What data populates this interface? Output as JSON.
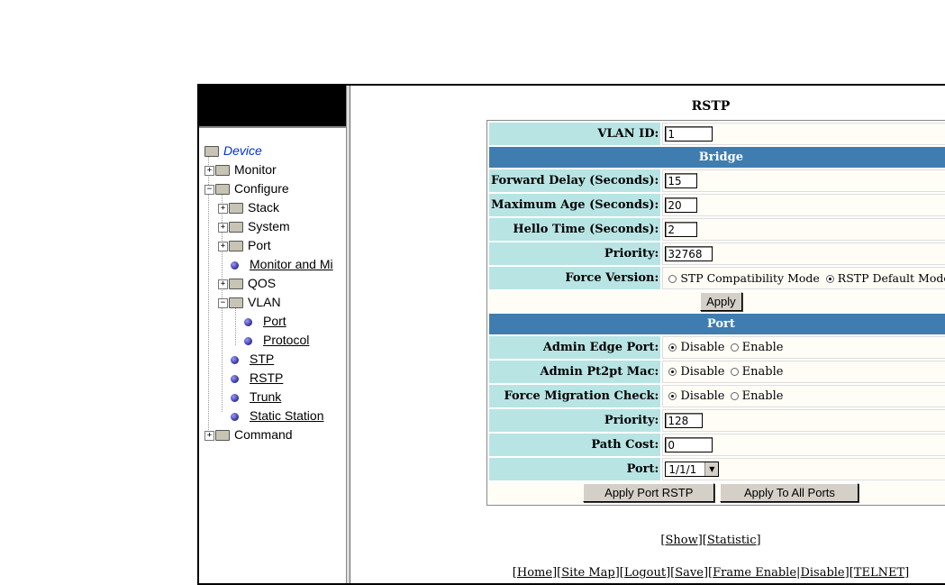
{
  "tree": {
    "root": "Device",
    "monitor": "Monitor",
    "configure": "Configure",
    "stack": "Stack",
    "system": "System",
    "port": "Port",
    "monitor_mirror": "Monitor and Mi",
    "qos": "QOS",
    "vlan": "VLAN",
    "vlan_port": "Port",
    "vlan_protocol": "Protocol",
    "stp": "STP",
    "rstp": "RSTP",
    "trunk": "Trunk",
    "static_station": "Static Station",
    "command": "Command"
  },
  "page": {
    "title": "RSTP"
  },
  "form": {
    "vlan_id_label": "VLAN ID:",
    "vlan_id_value": "1",
    "bridge_header": "Bridge",
    "forward_delay_label": "Forward Delay (Seconds):",
    "forward_delay_value": "15",
    "max_age_label": "Maximum Age (Seconds):",
    "max_age_value": "20",
    "hello_time_label": "Hello Time (Seconds):",
    "hello_time_value": "2",
    "bridge_priority_label": "Priority:",
    "bridge_priority_value": "32768",
    "force_version_label": "Force Version:",
    "force_version_opt1": "STP Compatibility Mode",
    "force_version_opt2": "RSTP Default Mode",
    "apply_button": "Apply",
    "port_header": "Port",
    "admin_edge_label": "Admin Edge Port:",
    "admin_p2p_label": "Admin Pt2pt Mac:",
    "force_migration_label": "Force Migration Check:",
    "disable": "Disable",
    "enable": "Enable",
    "port_priority_label": "Priority:",
    "port_priority_value": "128",
    "path_cost_label": "Path Cost:",
    "path_cost_value": "0",
    "port_label": "Port:",
    "port_value": "1/1/1",
    "apply_port_button": "Apply Port RSTP",
    "apply_all_button": "Apply To All Ports"
  },
  "links": {
    "show": "Show",
    "statistic": "Statistic",
    "home": "Home",
    "site_map": "Site Map",
    "logout": "Logout",
    "save": "Save",
    "frame_enable": "Frame Enable",
    "disable": "Disable",
    "telnet": "TELNET"
  }
}
